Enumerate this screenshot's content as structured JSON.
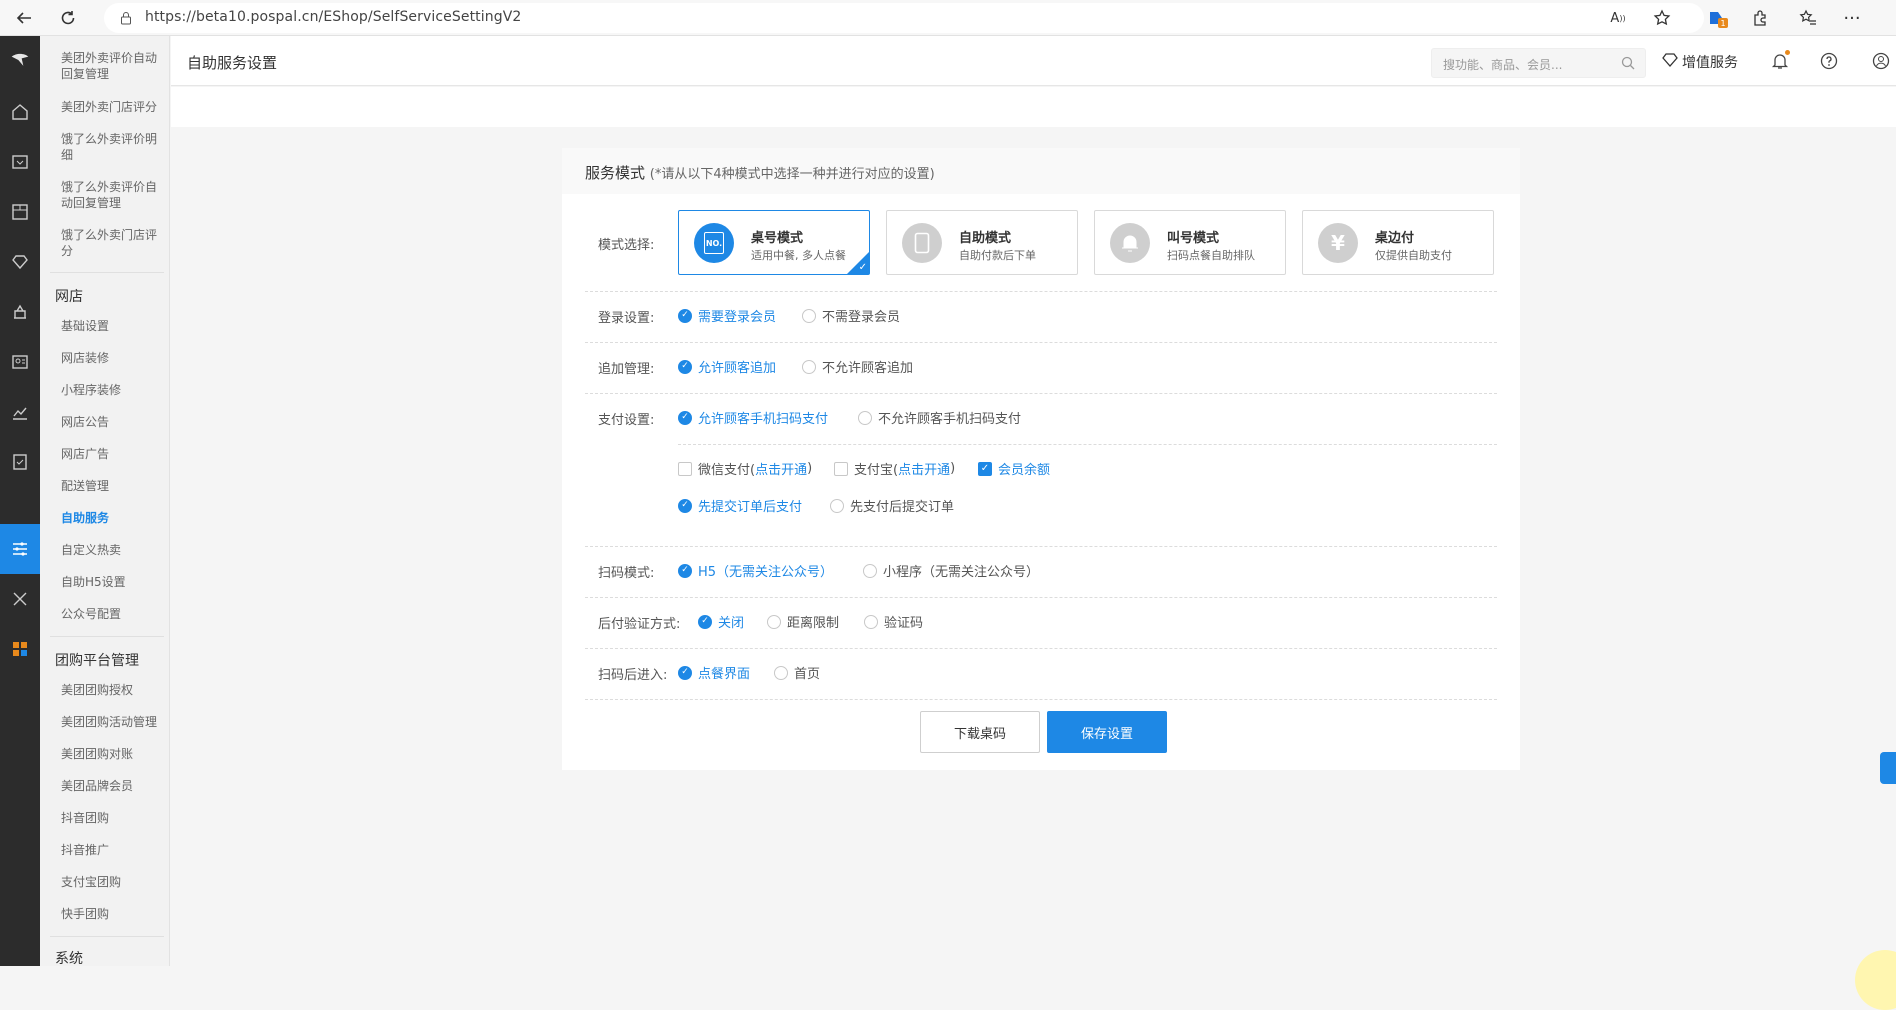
{
  "browser": {
    "url": "https://beta10.pospal.cn/EShop/SelfServiceSettingV2",
    "extension_badge": "1"
  },
  "sidebar": {
    "items_top": [
      "美团外卖评价自动回复管理",
      "美团外卖门店评分",
      "饿了么外卖评价明细",
      "饿了么外卖评价自动回复管理",
      "饿了么外卖门店评分"
    ],
    "section_shop": "网店",
    "items_shop": [
      "基础设置",
      "网店装修",
      "小程序装修",
      "网店公告",
      "网店广告",
      "配送管理",
      "自助服务",
      "自定义热卖",
      "自助H5设置",
      "公众号配置"
    ],
    "section_group": "团购平台管理",
    "items_group": [
      "美团团购授权",
      "美团团购活动管理",
      "美团团购对账",
      "美团品牌会员",
      "抖音团购",
      "抖音推广",
      "支付宝团购",
      "快手团购"
    ],
    "section_system": "系统"
  },
  "header": {
    "title": "自助服务设置",
    "search_placeholder": "搜功能、商品、会员...",
    "vip_label": "增值服务"
  },
  "panel": {
    "title": "服务模式",
    "hint": "(*请从以下4种模式中选择一种并进行对应的设置)",
    "mode_label": "模式选择:",
    "modes": [
      {
        "name": "桌号模式",
        "desc": "适用中餐, 多人点餐",
        "icon_text": "NO.",
        "selected": true
      },
      {
        "name": "自助模式",
        "desc": "自助付款后下单",
        "icon_text": "",
        "selected": false
      },
      {
        "name": "叫号模式",
        "desc": "扫码点餐自助排队",
        "icon_text": "",
        "selected": false
      },
      {
        "name": "桌边付",
        "desc": "仅提供自助支付",
        "icon_text": "¥",
        "selected": false
      }
    ],
    "login": {
      "label": "登录设置:",
      "opt1": "需要登录会员",
      "opt2": "不需登录会员"
    },
    "append": {
      "label": "追加管理:",
      "opt1": "允许顾客追加",
      "opt2": "不允许顾客追加"
    },
    "pay": {
      "label": "支付设置:",
      "opt1": "允许顾客手机扫码支付",
      "opt2": "不允许顾客手机扫码支付",
      "wechat_label": "微信支付(",
      "wechat_link": "点击开通",
      "wechat_end": ")",
      "alipay_label": "支付宝(",
      "alipay_link": "点击开通",
      "alipay_end": ")",
      "balance": "会员余额",
      "order_first": "先提交订单后支付",
      "pay_first": "先支付后提交订单"
    },
    "scan_mode": {
      "label": "扫码模式:",
      "opt1": "H5（无需关注公众号）",
      "opt2": "小程序（无需关注公众号）"
    },
    "verify": {
      "label": "后付验证方式:",
      "opt1": "关闭",
      "opt2": "距离限制",
      "opt3": "验证码"
    },
    "enter": {
      "label": "扫码后进入:",
      "opt1": "点餐界面",
      "opt2": "首页"
    },
    "btn_download": "下载桌码",
    "btn_save": "保存设置"
  }
}
